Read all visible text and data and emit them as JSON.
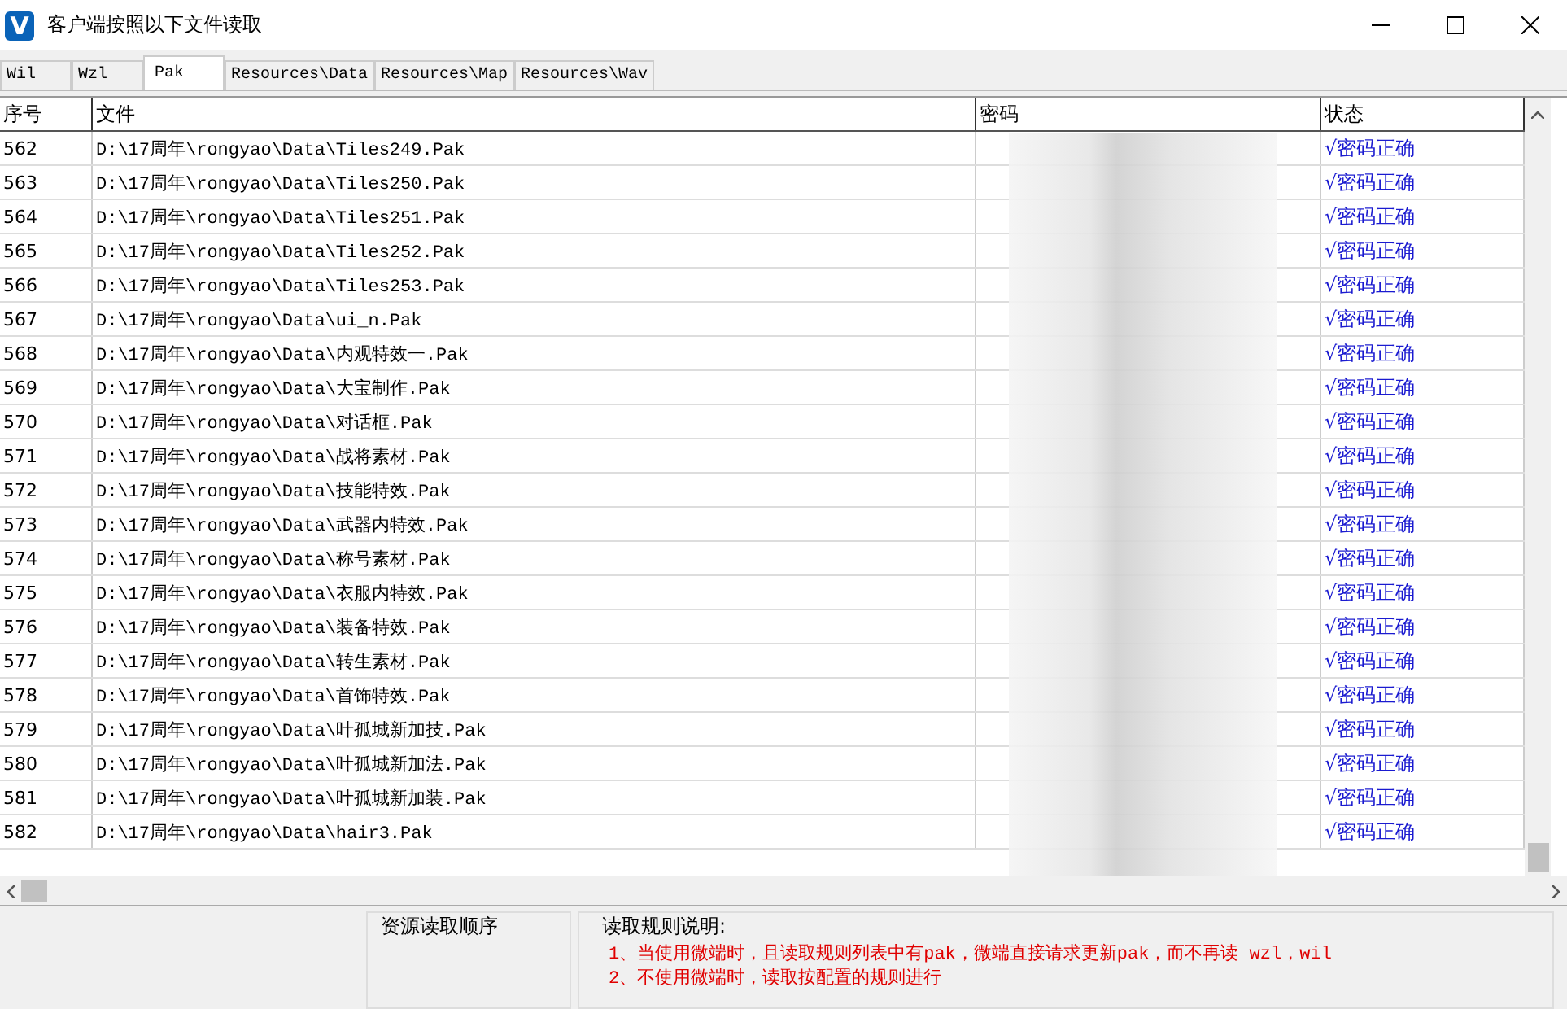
{
  "window": {
    "logo_text": "V",
    "title": "客户端按照以下文件读取"
  },
  "tabs": [
    {
      "label": "Wil",
      "selected": false
    },
    {
      "label": "Wzl",
      "selected": false
    },
    {
      "label": "Pak",
      "selected": true
    },
    {
      "label": "Resources\\Data",
      "selected": false
    },
    {
      "label": "Resources\\Map",
      "selected": false
    },
    {
      "label": "Resources\\Wav",
      "selected": false
    }
  ],
  "table": {
    "columns": [
      "序号",
      "文件",
      "密码",
      "状态"
    ],
    "rows": [
      {
        "no": "562",
        "file": "D:\\17周年\\rongyao\\Data\\Tiles249.Pak",
        "status": "√密码正确"
      },
      {
        "no": "563",
        "file": "D:\\17周年\\rongyao\\Data\\Tiles250.Pak",
        "status": "√密码正确"
      },
      {
        "no": "564",
        "file": "D:\\17周年\\rongyao\\Data\\Tiles251.Pak",
        "status": "√密码正确"
      },
      {
        "no": "565",
        "file": "D:\\17周年\\rongyao\\Data\\Tiles252.Pak",
        "status": "√密码正确"
      },
      {
        "no": "566",
        "file": "D:\\17周年\\rongyao\\Data\\Tiles253.Pak",
        "status": "√密码正确"
      },
      {
        "no": "567",
        "file": "D:\\17周年\\rongyao\\Data\\ui_n.Pak",
        "status": "√密码正确"
      },
      {
        "no": "568",
        "file": "D:\\17周年\\rongyao\\Data\\内观特效一.Pak",
        "status": "√密码正确"
      },
      {
        "no": "569",
        "file": "D:\\17周年\\rongyao\\Data\\大宝制作.Pak",
        "status": "√密码正确"
      },
      {
        "no": "570",
        "file": "D:\\17周年\\rongyao\\Data\\对话框.Pak",
        "status": "√密码正确"
      },
      {
        "no": "571",
        "file": "D:\\17周年\\rongyao\\Data\\战将素材.Pak",
        "status": "√密码正确"
      },
      {
        "no": "572",
        "file": "D:\\17周年\\rongyao\\Data\\技能特效.Pak",
        "status": "√密码正确"
      },
      {
        "no": "573",
        "file": "D:\\17周年\\rongyao\\Data\\武器内特效.Pak",
        "status": "√密码正确"
      },
      {
        "no": "574",
        "file": "D:\\17周年\\rongyao\\Data\\称号素材.Pak",
        "status": "√密码正确"
      },
      {
        "no": "575",
        "file": "D:\\17周年\\rongyao\\Data\\衣服内特效.Pak",
        "status": "√密码正确"
      },
      {
        "no": "576",
        "file": "D:\\17周年\\rongyao\\Data\\装备特效.Pak",
        "status": "√密码正确"
      },
      {
        "no": "577",
        "file": "D:\\17周年\\rongyao\\Data\\转生素材.Pak",
        "status": "√密码正确"
      },
      {
        "no": "578",
        "file": "D:\\17周年\\rongyao\\Data\\首饰特效.Pak",
        "status": "√密码正确"
      },
      {
        "no": "579",
        "file": "D:\\17周年\\rongyao\\Data\\叶孤城新加技.Pak",
        "status": "√密码正确"
      },
      {
        "no": "580",
        "file": "D:\\17周年\\rongyao\\Data\\叶孤城新加法.Pak",
        "status": "√密码正确"
      },
      {
        "no": "581",
        "file": "D:\\17周年\\rongyao\\Data\\叶孤城新加装.Pak",
        "status": "√密码正确"
      },
      {
        "no": "582",
        "file": "D:\\17周年\\rongyao\\Data\\hair3.Pak",
        "status": "√密码正确"
      }
    ]
  },
  "order_panel": {
    "title": "资源读取顺序"
  },
  "rules_panel": {
    "title": "读取规则说明:",
    "lines": [
      "1、当使用微端时，且读取规则列表中有pak，微端直接请求更新pak，而不再读 wzl，wil",
      "2、不使用微端时，读取按配置的规则进行"
    ]
  }
}
